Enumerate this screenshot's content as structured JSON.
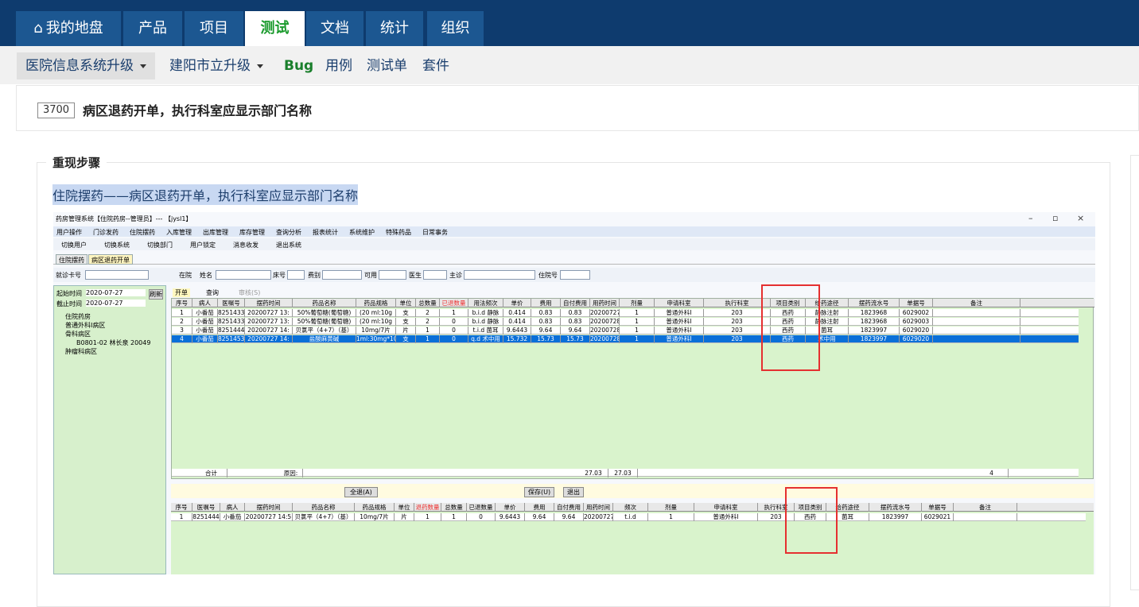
{
  "topnav": {
    "tabs": [
      {
        "label": "我的地盘",
        "icon": "home-icon"
      },
      {
        "label": "产品"
      },
      {
        "label": "项目"
      },
      {
        "label": "测试",
        "active": true
      },
      {
        "label": "文档"
      },
      {
        "label": "统计"
      },
      {
        "label": "组织"
      }
    ]
  },
  "subnav": {
    "product": "医院信息系统升级",
    "branch": "建阳市立升级",
    "bug": "Bug",
    "case": "用例",
    "testtask": "测试单",
    "suite": "套件"
  },
  "bug": {
    "id": "3700",
    "title": "病区退药开单，执行科室应显示部门名称"
  },
  "steps": {
    "legend": "重现步骤",
    "text": "住院摆药——病区退药开单，执行科室应显示部门名称"
  },
  "screenshot": {
    "window_title": "药房管理系统【住院药房--管理员】--- 【jysl1】",
    "window_controls": {
      "min": "–",
      "max": "▫",
      "close": "×"
    },
    "menu": [
      "用户操作",
      "门诊发药",
      "住院摆药",
      "入库管理",
      "出库管理",
      "库存管理",
      "查询分析",
      "报表统计",
      "系统维护",
      "特殊药品",
      "日常事务"
    ],
    "toolbar": [
      "切换用户",
      "切换系统",
      "切换部门",
      "用户锁定",
      "消息收发",
      "退出系统"
    ],
    "tabs": [
      "住院摆药",
      "病区退药开单"
    ],
    "filter": {
      "card": "就诊卡号",
      "status": "在院",
      "name": "姓名",
      "bed": "床号",
      "fee": "费别",
      "avail": "可用",
      "doctor": "医生",
      "diag": "主诊",
      "inpatient": "住院号"
    },
    "dates": {
      "start_label": "起始时间",
      "start": "2020-07-27",
      "end_label": "截止时间",
      "end": "2020-07-27",
      "refresh": "刷新"
    },
    "tree": [
      "住院药房",
      "普通外科Ⅰ病区",
      "骨科病区",
      "B0801-02 林长泉 20049",
      "肿瘤科病区"
    ],
    "grid_tabs": {
      "open": "开单",
      "query": "查询",
      "other": "审核(S)"
    },
    "columns": [
      "序号",
      "病人",
      "医嘱号",
      "摆药时间",
      "药品名称",
      "药品规格",
      "单位",
      "总数量",
      "已退数量",
      "用法频次",
      "单价",
      "费用",
      "自付费用",
      "用药时间",
      "剂量",
      "申请科室",
      "执行科室",
      "项目类别",
      "给药途径",
      "摆药流水号",
      "单据号",
      "备注"
    ],
    "rows": [
      [
        "1",
        "小番茄",
        "8251433",
        "20200727 13:",
        "50%葡萄糖(葡萄糖)",
        "(20 ml:10g",
        "支",
        "2",
        "1",
        "b.i.d 静脉",
        "0.414",
        "0.83",
        "0.83",
        "20200727",
        "1",
        "普通外科Ⅰ",
        "203",
        "西药",
        "静脉注射",
        "1823968",
        "6029002",
        ""
      ],
      [
        "2",
        "小番茄",
        "8251433",
        "20200727 13:",
        "50%葡萄糖(葡萄糖)",
        "(20 ml:10g",
        "支",
        "2",
        "0",
        "b.i.d 静脉",
        "0.414",
        "0.83",
        "0.83",
        "20200728",
        "1",
        "普通外科Ⅰ",
        "203",
        "西药",
        "静脉注射",
        "1823968",
        "6029003",
        ""
      ],
      [
        "3",
        "小番茄",
        "8251444",
        "20200727 14:",
        "贝氯平（4+7）（基）",
        "10mg/7片",
        "片",
        "1",
        "0",
        "t.i.d 菌耳",
        "9.6443",
        "9.64",
        "9.64",
        "20200728",
        "1",
        "普通外科Ⅰ",
        "203",
        "西药",
        "菌耳",
        "1823997",
        "6029020",
        ""
      ],
      [
        "4",
        "小番茄",
        "8251453",
        "20200727 14:",
        "盐酸麻黄碱",
        "1ml:30mg*10",
        "支",
        "1",
        "0",
        "q.d 术中用",
        "15.732",
        "15.73",
        "15.73",
        "20200728",
        "1",
        "普通外科Ⅰ",
        "203",
        "西药",
        "术中用",
        "1823997",
        "6029020",
        ""
      ]
    ],
    "summary": {
      "label": "合计",
      "reason": "原因:",
      "fee": "27.03",
      "self": "27.03",
      "count": "4"
    },
    "buttons": {
      "all_return": "全退(A)",
      "save": "保存(U)",
      "exit": "退出"
    },
    "bottom_columns": [
      "序号",
      "医嘱号",
      "病人",
      "摆药时间",
      "药品名称",
      "药品规格",
      "单位",
      "退药数量",
      "总数量",
      "已退数量",
      "单价",
      "费用",
      "自付费用",
      "用药时间",
      "频次",
      "剂量",
      "申请科室",
      "执行科室",
      "项目类别",
      "给药途径",
      "摆药流水号",
      "单据号",
      "备注"
    ],
    "bottom_rows": [
      [
        "1",
        "8251444",
        "小番茄",
        "20200727 14:5",
        "贝氯平（4+7）（基）",
        "10mg/7片",
        "片",
        "1",
        "1",
        "0",
        "9.6443",
        "9.64",
        "9.64",
        "20200727",
        "t.i.d",
        "1",
        "普通外科Ⅰ",
        "203",
        "西药",
        "菌耳",
        "1823997",
        "6029021",
        ""
      ]
    ]
  }
}
